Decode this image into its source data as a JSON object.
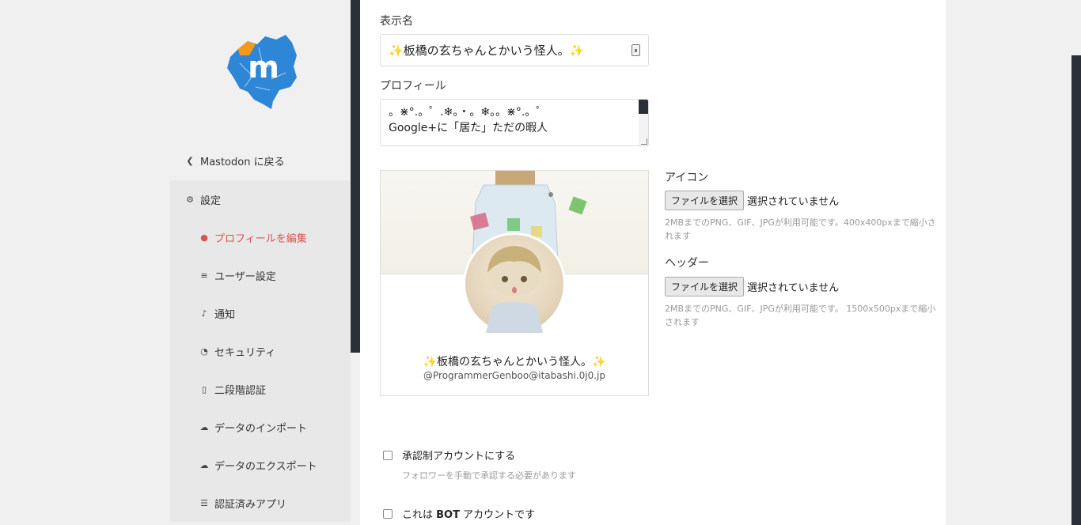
{
  "sidebar": {
    "back_label": "Mastodon に戻る",
    "settings_label": "設定",
    "items": [
      {
        "label": "プロフィールを編集",
        "icon": "user-icon",
        "active": true
      },
      {
        "label": "ユーザー設定",
        "icon": "sliders-icon",
        "active": false
      },
      {
        "label": "通知",
        "icon": "bell-icon",
        "active": false
      },
      {
        "label": "セキュリティ",
        "icon": "lock-icon",
        "active": false
      },
      {
        "label": "二段階認証",
        "icon": "mobile-icon",
        "active": false
      },
      {
        "label": "データのインポート",
        "icon": "cloud-upload-icon",
        "active": false
      },
      {
        "label": "データのエクスポート",
        "icon": "cloud-download-icon",
        "active": false
      },
      {
        "label": "認証済みアプリ",
        "icon": "list-icon",
        "active": false
      }
    ],
    "accent_color": "#d9534f"
  },
  "form": {
    "display_name_label": "表示名",
    "display_name_value": "✨板橋の玄ちゃんとかいう怪人。✨",
    "bio_label": "プロフィール",
    "bio_line1": "。⋇°.。゜.❄。・。❄。。⋇°.。゜",
    "bio_line2": "Google+に「居た」ただの暇人",
    "avatar_label": "アイコン",
    "avatar_button": "ファイルを選択",
    "avatar_status": "選択されていません",
    "avatar_hint": "2MBまでのPNG、GIF、JPGが利用可能です。400x400pxまで縮小されます",
    "header_label": "ヘッダー",
    "header_button": "ファイルを選択",
    "header_status": "選択されていません",
    "header_hint": "2MBまでのPNG、GIF、JPGが利用可能です。 1500x500pxまで縮小されます",
    "locked_label": "承認制アカウントにする",
    "locked_hint": "フォロワーを手動で承認する必要があります",
    "bot_label_prefix": "これは ",
    "bot_label_bold": "BOT",
    "bot_label_suffix": " アカウントです"
  },
  "preview": {
    "display_name": "✨板橋の玄ちゃんとかいう怪人。✨",
    "handle": "@ProgrammerGenboo@itabashi.0j0.jp"
  }
}
